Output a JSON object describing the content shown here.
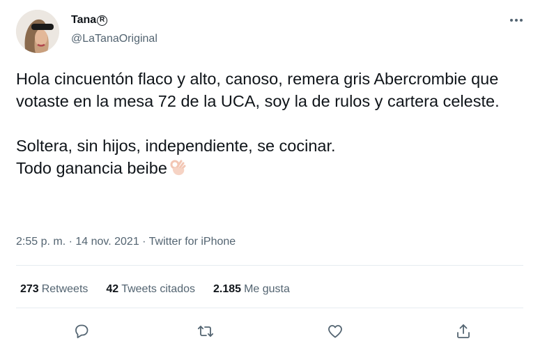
{
  "author": {
    "name": "Tana",
    "badge": "R",
    "handle": "@LaTanaOriginal"
  },
  "tweet": {
    "paragraph1": "Hola cincuentón flaco y alto, canoso, remera gris Abercrombie que votaste en la mesa 72 de la UCA, soy la de rulos y cartera celeste.",
    "paragraph2_line1": "Soltera, sin hijos, independiente, se cocinar.",
    "paragraph2_line2": "Todo ganancia beibe",
    "emoji": "ok-hand-emoji"
  },
  "meta": {
    "time": "2:55 p. m.",
    "separator1": " · ",
    "date": "14 nov. 2021",
    "separator2": " · ",
    "source": "Twitter for iPhone"
  },
  "stats": {
    "retweets_count": "273",
    "retweets_label": "Retweets",
    "quotes_count": "42",
    "quotes_label": "Tweets citados",
    "likes_count": "2.185",
    "likes_label": "Me gusta"
  },
  "actions": {
    "reply_icon": "reply-icon",
    "retweet_icon": "retweet-icon",
    "like_icon": "heart-icon",
    "share_icon": "share-icon",
    "more_icon": "more-icon"
  },
  "colors": {
    "text_primary": "#0f1419",
    "text_secondary": "#536471",
    "divider": "#e6ecf0"
  }
}
